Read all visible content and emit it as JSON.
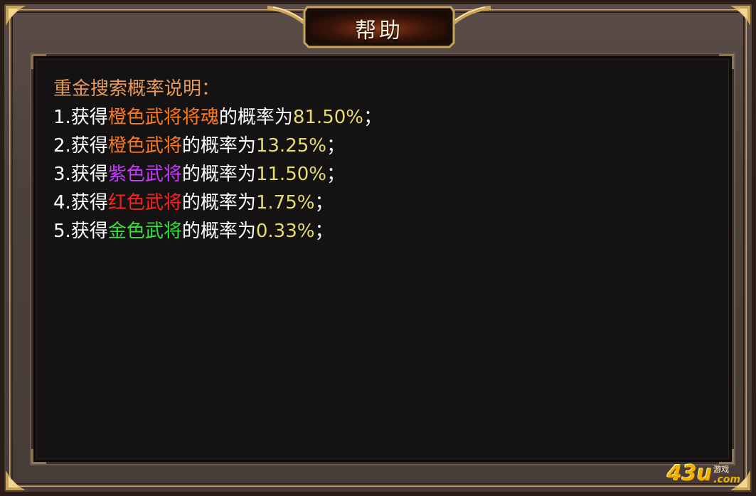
{
  "dialog": {
    "title": "帮助"
  },
  "help": {
    "heading": "重金搜索概率说明：",
    "lines": [
      {
        "prefix": "1.获得",
        "item": "橙色武将将魂",
        "mid": "的概率为",
        "pct": "81.50%",
        "end": "；"
      },
      {
        "prefix": "2.获得",
        "item": "橙色武将",
        "mid": "的概率为",
        "pct": "13.25%",
        "end": "；"
      },
      {
        "prefix": "3.获得",
        "item": "紫色武将",
        "mid": "的概率为",
        "pct": "11.50%",
        "end": "；"
      },
      {
        "prefix": "4.获得",
        "item": "红色武将",
        "mid": "的概率为",
        "pct": "1.75%",
        "end": "；"
      },
      {
        "prefix": "5.获得",
        "item": "金色武将",
        "mid": "的概率为",
        "pct": "0.33%",
        "end": "；"
      }
    ]
  },
  "colors": {
    "heading": "#e49a5a",
    "orange": "#ff7a1a",
    "purple": "#c43cff",
    "red": "#ff2020",
    "green": "#36e236",
    "percent": "#e8dc6a"
  },
  "watermark": {
    "main": "43u",
    "top": "游戏",
    "bottom": ".com"
  }
}
